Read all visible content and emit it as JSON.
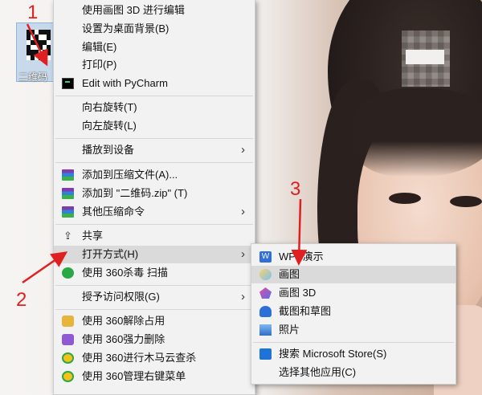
{
  "desktop": {
    "icon_label": "二维码"
  },
  "context_menu": {
    "items": [
      {
        "label": "使用画图 3D 进行编辑"
      },
      {
        "label": "设置为桌面背景(B)"
      },
      {
        "label": "编辑(E)"
      },
      {
        "label": "打印(P)"
      },
      {
        "label": "Edit with PyCharm"
      },
      {
        "label": "向右旋转(T)"
      },
      {
        "label": "向左旋转(L)"
      },
      {
        "label": "播放到设备"
      },
      {
        "label": "添加到压缩文件(A)..."
      },
      {
        "label": "添加到 \"二维码.zip\" (T)"
      },
      {
        "label": "其他压缩命令"
      },
      {
        "label": "共享"
      },
      {
        "label": "打开方式(H)"
      },
      {
        "label": "使用 360杀毒 扫描"
      },
      {
        "label": "授予访问权限(G)"
      },
      {
        "label": "使用 360解除占用"
      },
      {
        "label": "使用 360强力删除"
      },
      {
        "label": "使用 360进行木马云查杀"
      },
      {
        "label": "使用 360管理右键菜单"
      }
    ]
  },
  "open_with_menu": {
    "items": [
      {
        "label": "WPS演示"
      },
      {
        "label": "画图"
      },
      {
        "label": "画图 3D"
      },
      {
        "label": "截图和草图"
      },
      {
        "label": "照片"
      },
      {
        "label": "搜索 Microsoft Store(S)"
      },
      {
        "label": "选择其他应用(C)"
      }
    ]
  },
  "annotations": {
    "step1": "1",
    "step2": "2",
    "step3": "3"
  },
  "colors": {
    "annotation": "#e02020",
    "menu_bg": "#f2f2f2",
    "highlight": "#dadada"
  }
}
